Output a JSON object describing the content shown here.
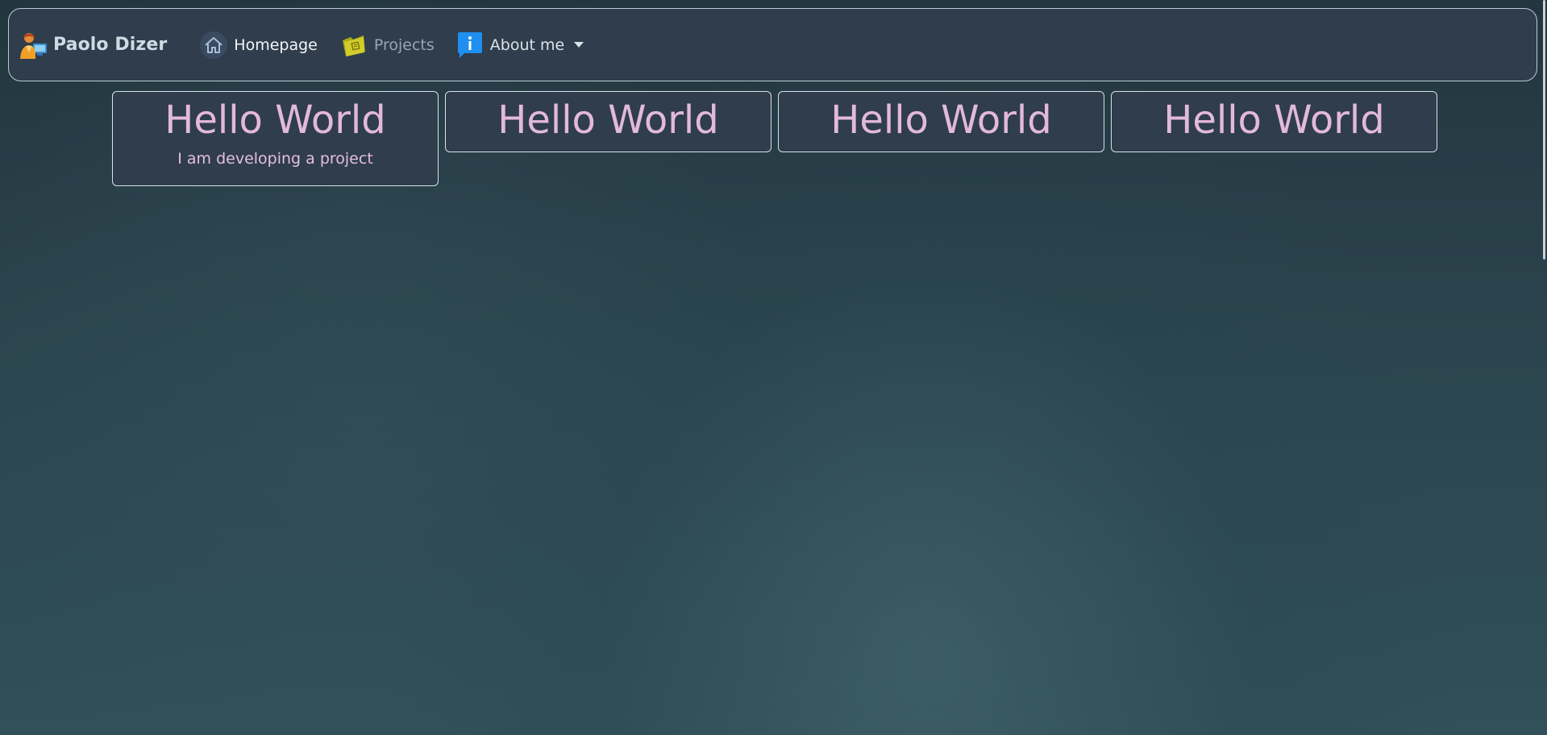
{
  "navbar": {
    "brand": {
      "name": "Paolo Dizer",
      "icon": "person-computer-logo-icon"
    },
    "items": [
      {
        "label": "Homepage",
        "icon": "home-icon",
        "color": "#f2f6f9"
      },
      {
        "label": "Projects",
        "icon": "folder-icon",
        "color": "#98a6b3"
      },
      {
        "label": "About me",
        "icon": "info-icon",
        "color": "#d9e2ea",
        "dropdown": true
      }
    ]
  },
  "cards": [
    {
      "title": "Hello World",
      "text": "I am developing a project"
    },
    {
      "title": "Hello World"
    },
    {
      "title": "Hello World"
    },
    {
      "title": "Hello World"
    }
  ],
  "colors": {
    "navbar_bg": "#2f3d4c",
    "border": "#b9cbd6",
    "card_title": "#e3b9da",
    "brand_text": "#cfdbe4"
  }
}
